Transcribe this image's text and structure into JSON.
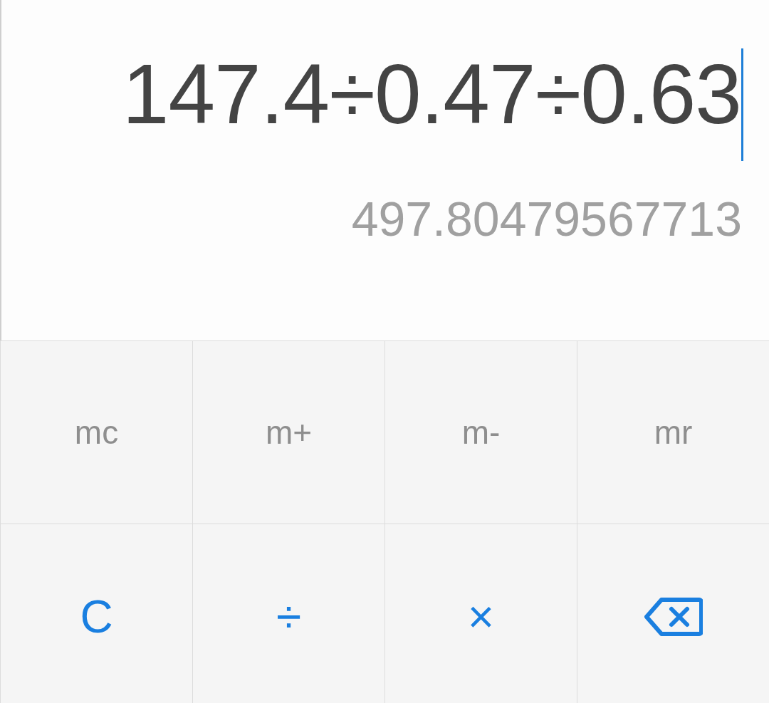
{
  "display": {
    "expression": "147.4÷0.47÷0.63",
    "cursor_visible": true,
    "result": "497.80479567713"
  },
  "keypad": [
    [
      {
        "kind": "memory",
        "label": "mc"
      },
      {
        "kind": "memory",
        "label": "m+"
      },
      {
        "kind": "memory",
        "label": "m-"
      },
      {
        "kind": "memory",
        "label": "mr"
      }
    ],
    [
      {
        "kind": "operator",
        "label": "C"
      },
      {
        "kind": "operator",
        "label": "÷"
      },
      {
        "kind": "operator",
        "label": "×"
      },
      {
        "kind": "backspace"
      }
    ]
  ]
}
